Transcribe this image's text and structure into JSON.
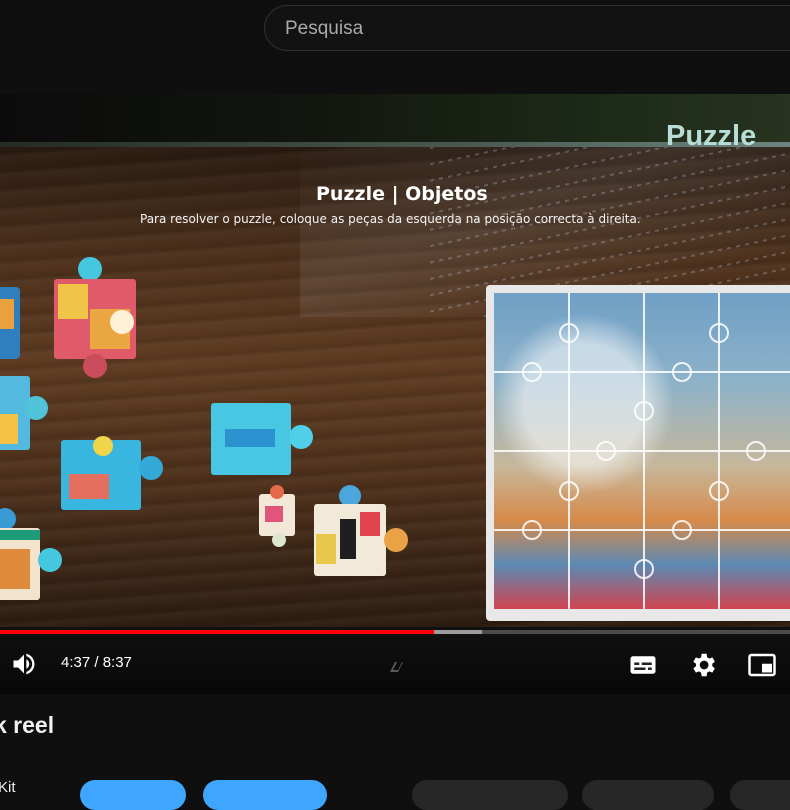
{
  "search": {
    "placeholder": "Pesquisa"
  },
  "video": {
    "brand_text": "Puzzle",
    "game_title": "Puzzle | Objetos",
    "game_instructions": "Para resolver o puzzle, coloque as peças da esquerda na posição correcta à direita.",
    "time_display": "4:37 / 8:37",
    "progress_fraction": 0.549,
    "buffered_fraction": 0.61
  },
  "below": {
    "title": "k reel",
    "partial_text": "Kit"
  },
  "icons": {
    "volume": "volume-icon",
    "subtitles": "subtitles-icon",
    "settings": "gear-icon",
    "miniplayer": "miniplayer-icon"
  },
  "colors": {
    "accent": "#ff0000",
    "subscribe_blue": "#3ea6ff",
    "background": "#0f0f0f"
  }
}
